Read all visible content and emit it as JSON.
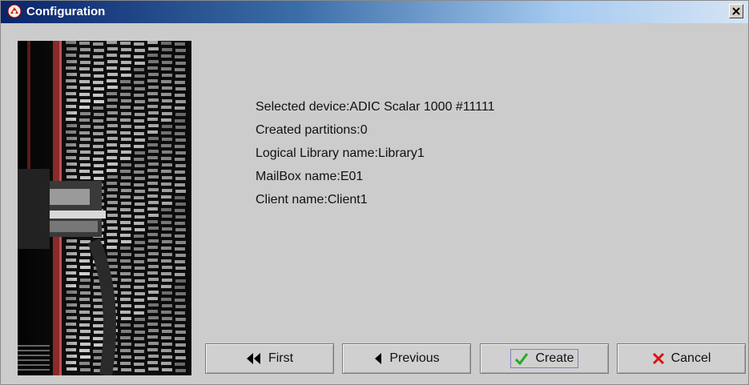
{
  "window": {
    "title": "Configuration",
    "title_icon": "app-icon",
    "close_icon": "close-icon"
  },
  "image": {
    "description_icon": "tape-library-photo"
  },
  "summary": {
    "lines": [
      "Selected device:ADIC Scalar 1000 #11111",
      "Created partitions:0",
      "Logical Library name:Library1",
      "MailBox name:E01",
      "Client name:Client1"
    ]
  },
  "buttons": {
    "first": {
      "label": "First",
      "icon": "double-left-arrow-icon"
    },
    "previous": {
      "label": "Previous",
      "icon": "left-arrow-icon"
    },
    "create": {
      "label": "Create",
      "icon": "checkmark-icon"
    },
    "cancel": {
      "label": "Cancel",
      "icon": "x-icon"
    }
  },
  "colors": {
    "title_start": "#0a246a",
    "title_end": "#d6e4f5",
    "create_check": "#22aa22",
    "cancel_x": "#dd1111"
  }
}
